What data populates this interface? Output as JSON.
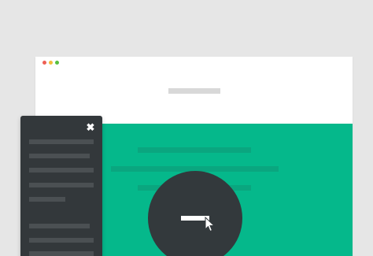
{
  "window": {
    "controls": [
      {
        "name": "close",
        "color": "#ee5f55"
      },
      {
        "name": "minimize",
        "color": "#f2bd3a"
      },
      {
        "name": "maximize",
        "color": "#57c03f"
      }
    ]
  },
  "colors": {
    "background": "#e6e6e6",
    "browser": "#ffffff",
    "hero": "#05b88b",
    "hero_placeholder": "#0aa67f",
    "panel": "#33383b",
    "panel_item": "#4b5053",
    "fab": "#33393c"
  },
  "side_panel": {
    "close_icon": "✖",
    "items": [
      "",
      "",
      "",
      "",
      "",
      "",
      "",
      ""
    ]
  },
  "fab": {
    "icon": "minus-bar",
    "cursor_icon": "pointer-arrow"
  }
}
